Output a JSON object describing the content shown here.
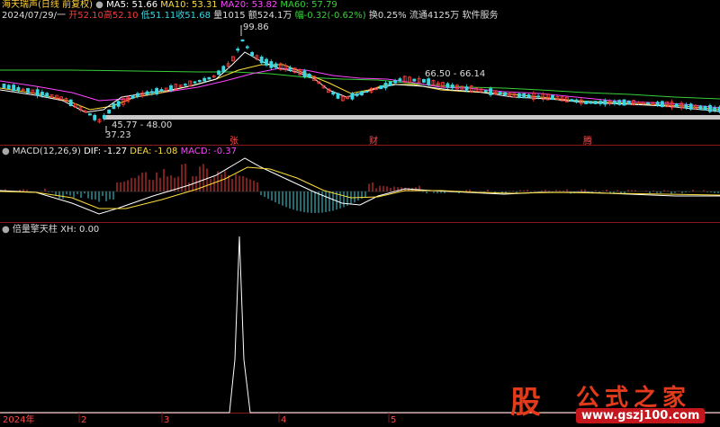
{
  "header": {
    "name": "海天瑞声",
    "adjust": "(日线 前复权)",
    "ma5": "MA5: 51.66",
    "ma10": "MA10: 53.31",
    "ma20": "MA20: 53.82",
    "ma60": "MA60: 57.79",
    "row2_date": "2024/07/29/一",
    "open": "开52.10",
    "high": "高52.10",
    "low": "低51.11",
    "close": "收51.68",
    "vol": "量1015",
    "amount": "额524.1万",
    "change": "幅-0.32(-0.62%)",
    "turnover": "换0.25%",
    "float": "流通4125万",
    "industry": "软件服务"
  },
  "price_annotations": {
    "high_label": "99.86",
    "low_label": "37.23",
    "range1": "45.77 - 48.00",
    "range2": "66.50 - 66.14"
  },
  "event_marks": {
    "m1": "张",
    "m2": "财",
    "m3": "腾"
  },
  "macd": {
    "label": "MACD(12,26,9)",
    "dif": "DIF: -1.27",
    "dea": "DEA: -1.08",
    "value": "MACD: -0.37"
  },
  "indicator": {
    "label": "倍量擎天柱",
    "xh": "XH: 0.00"
  },
  "axis": {
    "year": "2024年",
    "m2": "2",
    "m3": "3",
    "m4": "4",
    "m5": "5"
  },
  "logo": {
    "gu": "股",
    "title": "公式之家",
    "url": "www.gszj100.com"
  },
  "colors": {
    "up": "#ff3b3b",
    "down": "#3ad7e3",
    "ma5": "#ffffff",
    "ma10": "#ffde3a",
    "ma20": "#ff44ff",
    "ma60": "#38d038",
    "separator": "#8a1a1a"
  }
}
